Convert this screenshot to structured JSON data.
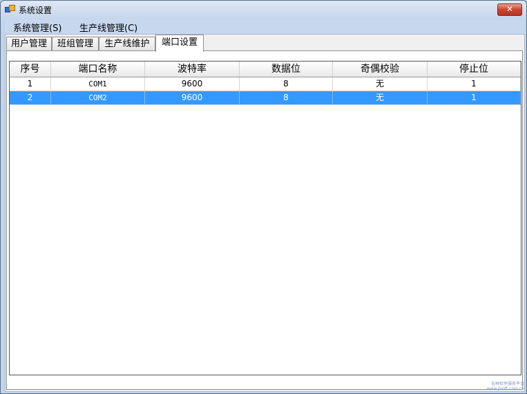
{
  "window": {
    "title": "系统设置",
    "close_glyph": "✕"
  },
  "menu": {
    "items": [
      "系统管理(S)",
      "生产线管理(C)"
    ]
  },
  "tabs": {
    "items": [
      "用户管理",
      "班组管理",
      "生产线维护",
      "端口设置"
    ],
    "active_index": 3
  },
  "grid": {
    "columns": [
      "序号",
      "端口名称",
      "波特率",
      "数据位",
      "奇偶校验",
      "停止位"
    ],
    "rows": [
      [
        "1",
        "COM1",
        "9600",
        "8",
        "无",
        "1"
      ],
      [
        "2",
        "COM2",
        "9600",
        "8",
        "无",
        "1"
      ]
    ],
    "selected_row_index": 1,
    "selection_color": "#3399ff"
  },
  "watermark": {
    "line1": "吉林软件服务平台",
    "line2": "www.jlsoft.com.cn"
  }
}
